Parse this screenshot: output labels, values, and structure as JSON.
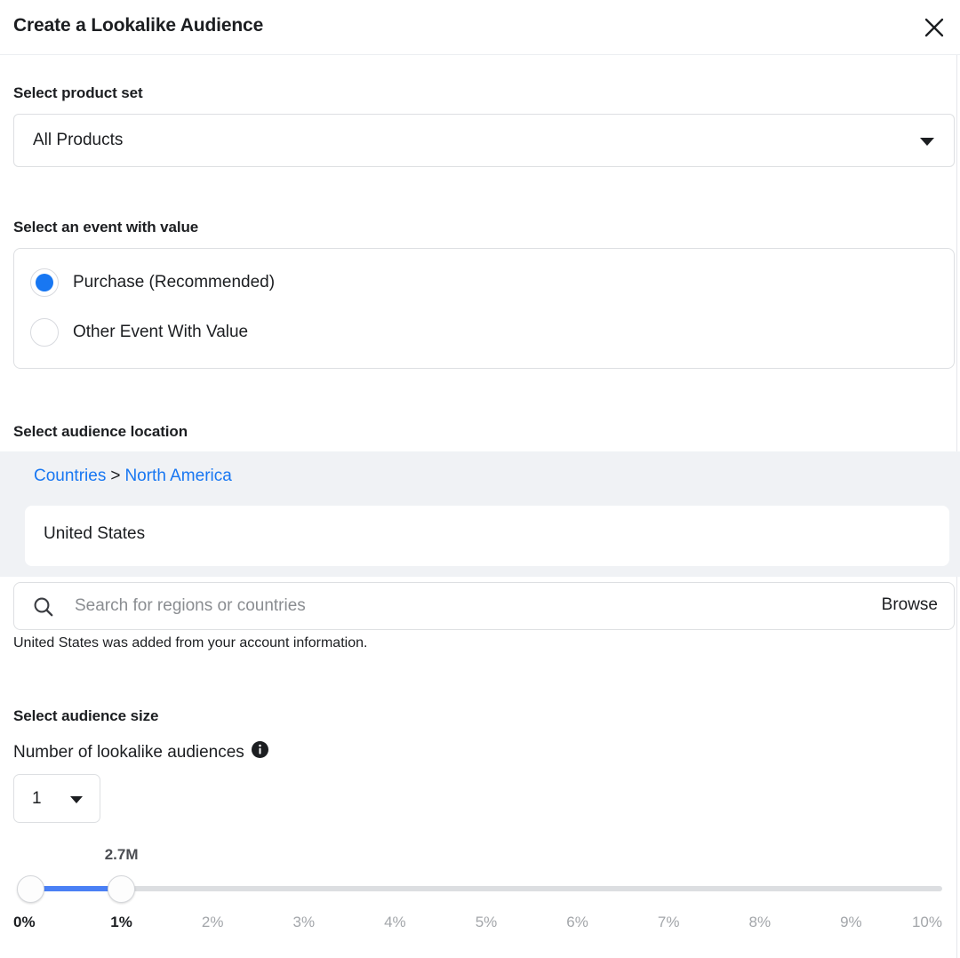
{
  "header": {
    "title": "Create a Lookalike Audience",
    "close_icon": "close-icon"
  },
  "product_set": {
    "label": "Select product set",
    "value": "All Products",
    "chevron_icon": "chevron-down-icon"
  },
  "event": {
    "label": "Select an event with value",
    "options": [
      {
        "label": "Purchase (Recommended)",
        "selected": true
      },
      {
        "label": "Other Event With Value",
        "selected": false
      }
    ]
  },
  "location": {
    "label": "Select audience location",
    "breadcrumb": {
      "root": "Countries",
      "separator": ">",
      "current": "North America"
    },
    "selected_location": "United States",
    "search_placeholder": "Search for regions or countries",
    "search_value": "",
    "search_icon": "search-icon",
    "browse_label": "Browse",
    "helper_text": "United States was added from your account information."
  },
  "audience_size": {
    "label": "Select audience size",
    "count_label": "Number of lookalike audiences",
    "info_icon": "info-icon",
    "count_value": "1",
    "count_chevron_icon": "chevron-down-icon"
  },
  "slider": {
    "value_label": "2.7M",
    "lower_percent": 0,
    "upper_percent": 1,
    "min": 0,
    "max": 10,
    "ticks": [
      {
        "label": "0%",
        "value": 0,
        "active": true
      },
      {
        "label": "1%",
        "value": 1,
        "active": true
      },
      {
        "label": "2%",
        "value": 2,
        "active": false
      },
      {
        "label": "3%",
        "value": 3,
        "active": false
      },
      {
        "label": "4%",
        "value": 4,
        "active": false
      },
      {
        "label": "5%",
        "value": 5,
        "active": false
      },
      {
        "label": "6%",
        "value": 6,
        "active": false
      },
      {
        "label": "7%",
        "value": 7,
        "active": false
      },
      {
        "label": "8%",
        "value": 8,
        "active": false
      },
      {
        "label": "9%",
        "value": 9,
        "active": false
      },
      {
        "label": "10%",
        "value": 10,
        "active": false
      }
    ]
  },
  "colors": {
    "accent_blue": "#1877f2",
    "slider_blue": "#4a80f5",
    "panel_gray": "#f0f2f5",
    "text_dark": "#1c1e21",
    "text_muted": "#a3a6aa"
  }
}
